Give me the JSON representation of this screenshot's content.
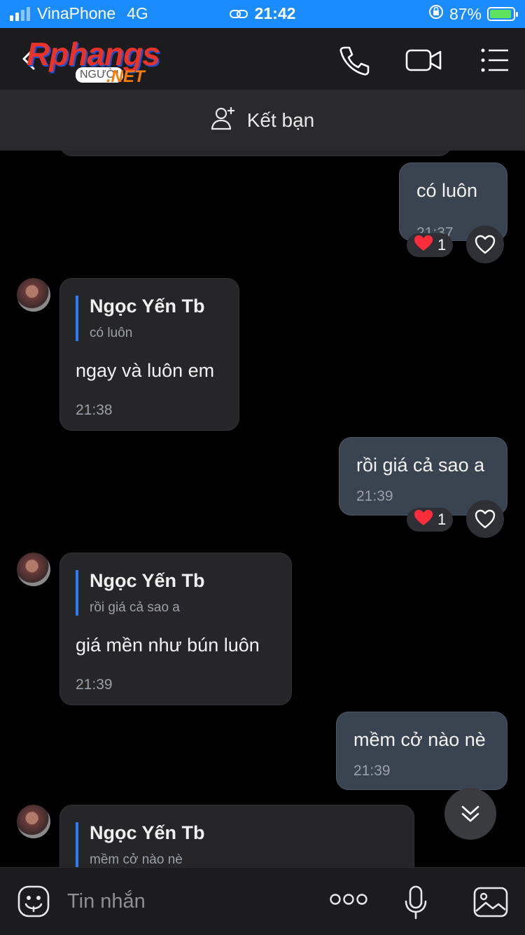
{
  "status": {
    "carrier": "VinaPhone",
    "network": "4G",
    "time": "21:42",
    "battery": "87%"
  },
  "header": {
    "logo": "Rphangs",
    "logo_sub": "NGƯỜI",
    "logo_net": ".NET"
  },
  "friend_bar": {
    "label": "Kết bạn"
  },
  "messages": {
    "m1": {
      "text": "có luôn",
      "time": "21:37",
      "reaction_count": "1"
    },
    "m2": {
      "reply_name": "Ngọc Yến Tb",
      "reply_text": "có luôn",
      "text": "ngay và luôn em",
      "time": "21:38"
    },
    "m3": {
      "text": "rồi giá cả sao a",
      "time": "21:39",
      "reaction_count": "1"
    },
    "m4": {
      "reply_name": "Ngọc Yến Tb",
      "reply_text": "rồi giá cả sao a",
      "text": "giá mền như bún luôn",
      "time": "21:39"
    },
    "m5": {
      "text": "mềm cở nào nè",
      "time": "21:39"
    },
    "m6": {
      "reply_name": "Ngọc Yến Tb",
      "reply_text": "mềm cở nào nè"
    }
  },
  "input": {
    "placeholder": "Tin nhắn"
  },
  "colors": {
    "status_bar": "#1a8cff",
    "outgoing_bubble": "#3a4350",
    "incoming_bubble": "#262628",
    "quote_accent": "#2d7cf6"
  }
}
